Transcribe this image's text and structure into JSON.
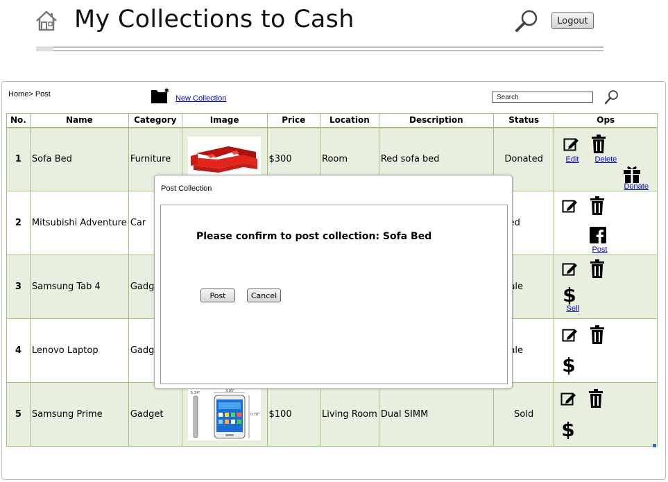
{
  "header": {
    "title": "My Collections to Cash",
    "logout_label": "Logout"
  },
  "toolbar": {
    "breadcrumb": "Home> Post",
    "new_collection_label": "New Collection",
    "search_placeholder": "Search"
  },
  "table": {
    "columns": [
      "No.",
      "Name",
      "Category",
      "Image",
      "Price",
      "Location",
      "Description",
      "Status",
      "Ops"
    ],
    "rows": [
      {
        "no": "1",
        "name": "Sofa Bed",
        "category": "Furniture",
        "price": "$300",
        "location": "Room",
        "description": "Red sofa bed",
        "status": "Donated"
      },
      {
        "no": "2",
        "name": "Mitsubishi Adventure",
        "category": "Car",
        "price": "",
        "location": "",
        "description": "",
        "status": "osted"
      },
      {
        "no": "3",
        "name": "Samsung Tab 4",
        "category": "Gadge",
        "price": "",
        "location": "",
        "description": "",
        "status": "n Sale"
      },
      {
        "no": "4",
        "name": "Lenovo Laptop",
        "category": "Gadge",
        "price": "",
        "location": "",
        "description": "",
        "status": "n Sale"
      },
      {
        "no": "5",
        "name": "Samsung Prime",
        "category": "Gadget",
        "price": "$100",
        "location": "Living Room",
        "description": "Dual SIMM",
        "status": "Sold"
      }
    ],
    "op_labels": {
      "edit": "Edit",
      "delete": "Delete",
      "donate": "Donate ",
      "post": "Post",
      "sell": "Sell"
    }
  },
  "modal": {
    "title": "Post Collection",
    "message": "Please confirm to post collection: Sofa Bed",
    "post_label": "Post",
    "cancel_label": "Cancel"
  },
  "image_labels": {
    "phone_dim_a": "5.34\"",
    "phone_dim_b": "3.05\"",
    "phone_dim_c": "0.76\""
  },
  "colors": {
    "grid_border": "#9fc37e",
    "row_shade": "#e9efdf",
    "link": "#0000cc",
    "sofa_red": "#d8201a"
  },
  "icons": [
    "home-icon",
    "search-icon",
    "folder-icon",
    "edit-icon",
    "trash-icon",
    "gift-icon",
    "facebook-icon",
    "dollar-icon"
  ]
}
